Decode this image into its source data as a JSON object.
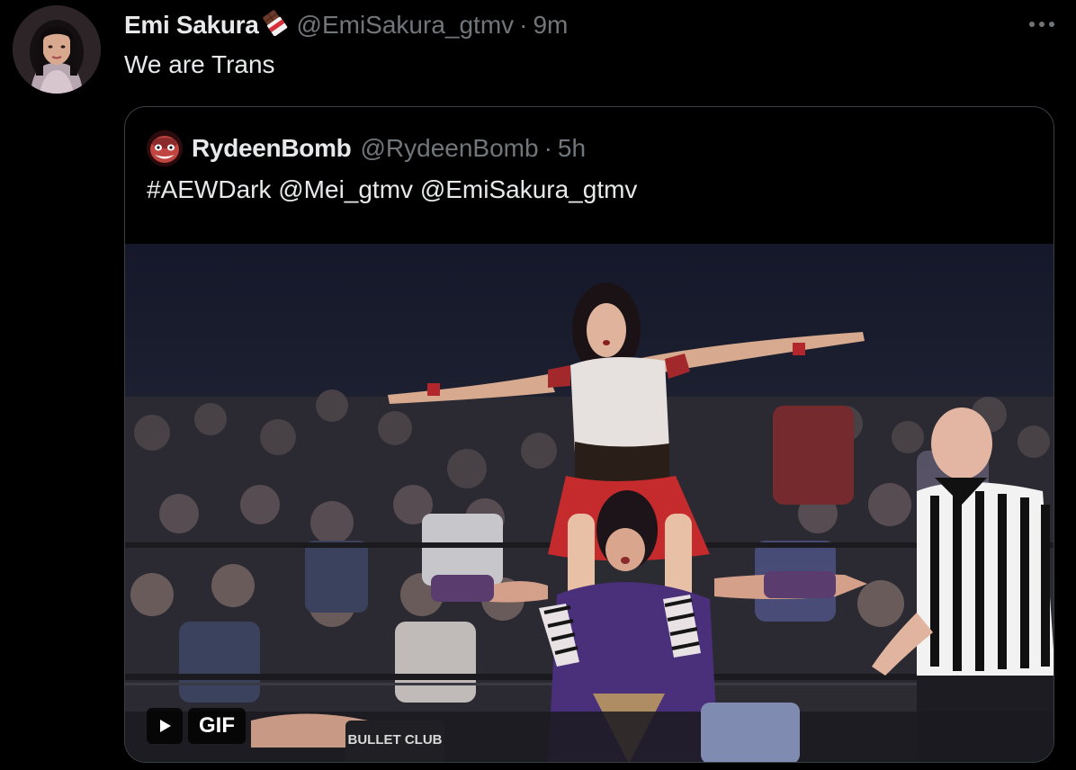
{
  "tweet": {
    "display_name": "Emi Sakura",
    "name_emoji": "chocolate-bar-icon",
    "handle": "@EmiSakura_gtmv",
    "separator": "·",
    "time": "9m",
    "text": "We are Trans",
    "more_icon": "more-horizontal-icon"
  },
  "quote": {
    "display_name": "RydeenBomb",
    "handle": "@RydeenBomb",
    "separator": "·",
    "time": "5h",
    "text": "#AEWDark @Mei_gtmv @EmiSakura_gtmv"
  },
  "media": {
    "type": "gif",
    "badge_label": "GIF",
    "play_icon": "play-icon",
    "overlay_shirt_text": "BULLET CLUB"
  },
  "colors": {
    "background": "#000000",
    "text_primary": "#e7e9ea",
    "text_secondary": "#71767b",
    "border": "#3a3f44"
  }
}
